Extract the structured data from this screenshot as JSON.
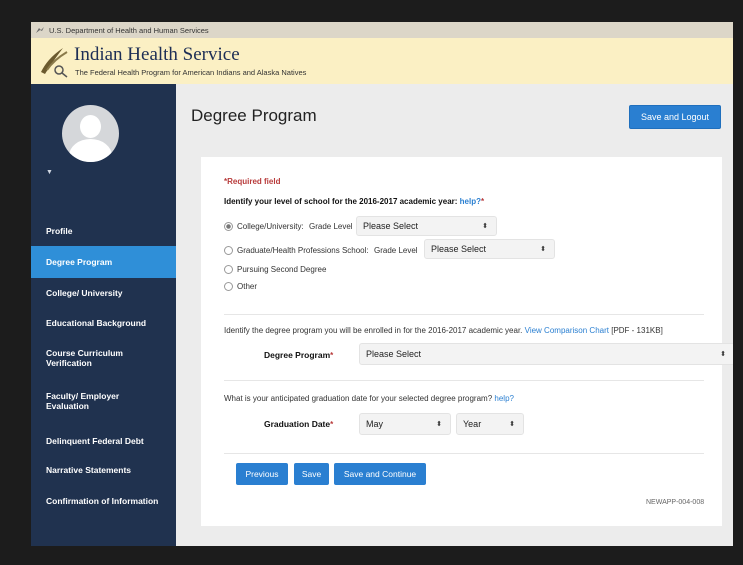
{
  "gov_bar": {
    "text": "U.S. Department of Health and Human Services"
  },
  "ihs": {
    "title": "Indian Health Service",
    "subtitle": "The Federal Health Program for American Indians and Alaska Natives"
  },
  "sidebar": {
    "items": [
      {
        "label": "Profile",
        "active": false
      },
      {
        "label": "Degree Program",
        "active": true
      },
      {
        "label": "College/ University",
        "active": false
      },
      {
        "label": "Educational Background",
        "active": false
      },
      {
        "label": "Course Curriculum Verification",
        "active": false
      },
      {
        "label": "Faculty/ Employer Evaluation",
        "active": false
      },
      {
        "label": "Delinquent Federal Debt",
        "active": false
      },
      {
        "label": "Narrative Statements",
        "active": false
      },
      {
        "label": "Confirmation of Information",
        "active": false
      }
    ]
  },
  "page": {
    "title": "Degree Program",
    "logout_label": "Save and Logout"
  },
  "form": {
    "required_note": "*Required field",
    "level_question": "Identify your level of school for the 2016-2017 academic year:",
    "level_help": "help?",
    "level_req": "*",
    "options": {
      "college": "College/University:",
      "graduate": "Graduate/Health Professions School:",
      "second": "Pursuing Second Degree",
      "other": "Other"
    },
    "grade_label": "Grade Level",
    "grade_select_1": "Please Select",
    "grade_select_2": "Please Select",
    "degree_prompt": "Identify the degree program you will be enrolled in for the 2016-2017 academic year.",
    "comparison_link": "View Comparison Chart",
    "comparison_suffix": "[PDF - 131KB]",
    "degree_label": "Degree Program",
    "degree_req": "*",
    "degree_select": "Please Select",
    "grad_prompt": "What is your anticipated graduation date for your selected degree program?",
    "grad_help": "help?",
    "grad_label": "Graduation Date",
    "grad_req": "*",
    "grad_month": "May",
    "grad_year": "Year",
    "btn_previous": "Previous",
    "btn_save": "Save",
    "btn_continue": "Save and Continue",
    "form_code": "NEWAPP-004-008"
  },
  "colors": {
    "sidebar_bg": "#20324f",
    "active_item": "#2f8fd8",
    "primary_button": "#2a7fd1",
    "required_red": "#b83b3b",
    "header_banner": "#fbf0c4"
  },
  "icons": [
    "hhs-eagle-icon",
    "ihs-logo-icon",
    "avatar-icon",
    "chevron-down-icon",
    "select-arrow-icon"
  ]
}
